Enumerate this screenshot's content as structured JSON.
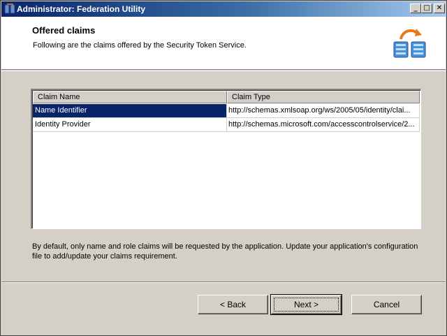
{
  "window": {
    "title": "Administrator: Federation Utility",
    "app_icon": "federation-utility-icon",
    "controls": {
      "minimize": "_",
      "maximize": "□",
      "close": "✕"
    }
  },
  "header": {
    "title": "Offered claims",
    "subtitle": "Following are the claims offered by the Security Token Service.",
    "icon": "servers-sync-icon"
  },
  "claims_table": {
    "columns": [
      "Claim Name",
      "Claim Type"
    ],
    "rows": [
      {
        "name": "Name Identifier",
        "type": "http://schemas.xmlsoap.org/ws/2005/05/identity/clai...",
        "selected": true
      },
      {
        "name": "Identity Provider",
        "type": "http://schemas.microsoft.com/accesscontrolservice/2...",
        "selected": false
      }
    ]
  },
  "info": "By default, only name and role claims will be requested by the application. Update your application's configuration file to add/update your claims requirement.",
  "buttons": {
    "back": "< Back",
    "next": "Next >",
    "cancel": "Cancel"
  },
  "colors": {
    "titlebar_start": "#0a246a",
    "titlebar_end": "#a6caf0",
    "selection": "#0a246a",
    "face": "#d4d0c8"
  }
}
